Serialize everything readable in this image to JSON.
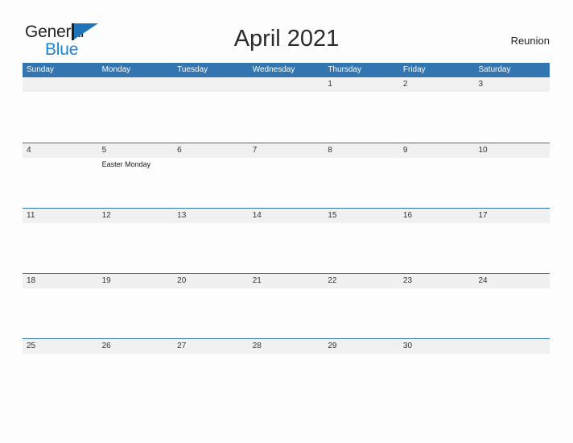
{
  "brand": {
    "name_part1": "General",
    "name_part2": "Blue",
    "flag_icon": "blue-flag-icon"
  },
  "header": {
    "title": "April 2021",
    "region": "Reunion"
  },
  "colors": {
    "header_blue": "#3375b0",
    "brand_blue": "#1b84d8",
    "flag_blue": "#1f73b8",
    "band_gray": "#f0f0f0",
    "page_background": "#fdfdfd",
    "text_dark": "#231f20"
  },
  "calendar": {
    "month": "April",
    "year": "2021",
    "weekdays": [
      "Sunday",
      "Monday",
      "Tuesday",
      "Wednesday",
      "Thursday",
      "Friday",
      "Saturday"
    ],
    "weeks": [
      {
        "days": [
          {
            "number": "",
            "events": []
          },
          {
            "number": "",
            "events": []
          },
          {
            "number": "",
            "events": []
          },
          {
            "number": "",
            "events": []
          },
          {
            "number": "1",
            "events": []
          },
          {
            "number": "2",
            "events": []
          },
          {
            "number": "3",
            "events": []
          }
        ]
      },
      {
        "days": [
          {
            "number": "4",
            "events": []
          },
          {
            "number": "5",
            "events": [
              "Easter Monday"
            ]
          },
          {
            "number": "6",
            "events": []
          },
          {
            "number": "7",
            "events": []
          },
          {
            "number": "8",
            "events": []
          },
          {
            "number": "9",
            "events": []
          },
          {
            "number": "10",
            "events": []
          }
        ]
      },
      {
        "days": [
          {
            "number": "11",
            "events": []
          },
          {
            "number": "12",
            "events": []
          },
          {
            "number": "13",
            "events": []
          },
          {
            "number": "14",
            "events": []
          },
          {
            "number": "15",
            "events": []
          },
          {
            "number": "16",
            "events": []
          },
          {
            "number": "17",
            "events": []
          }
        ]
      },
      {
        "days": [
          {
            "number": "18",
            "events": []
          },
          {
            "number": "19",
            "events": []
          },
          {
            "number": "20",
            "events": []
          },
          {
            "number": "21",
            "events": []
          },
          {
            "number": "22",
            "events": []
          },
          {
            "number": "23",
            "events": []
          },
          {
            "number": "24",
            "events": []
          }
        ]
      },
      {
        "days": [
          {
            "number": "25",
            "events": []
          },
          {
            "number": "26",
            "events": []
          },
          {
            "number": "27",
            "events": []
          },
          {
            "number": "28",
            "events": []
          },
          {
            "number": "29",
            "events": []
          },
          {
            "number": "30",
            "events": []
          },
          {
            "number": "",
            "events": []
          }
        ]
      }
    ]
  }
}
